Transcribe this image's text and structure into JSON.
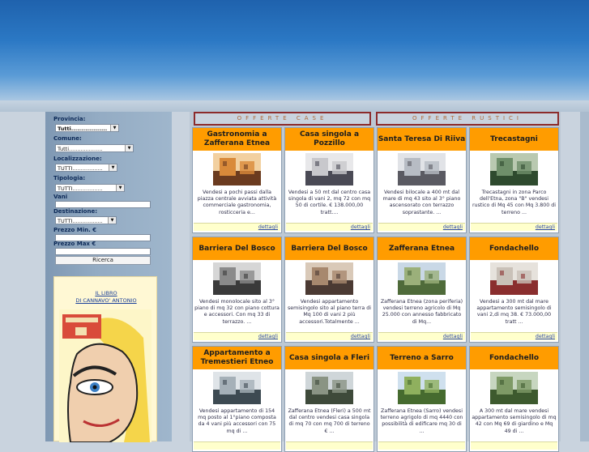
{
  "filters": {
    "provincia": {
      "label": "Provincia:",
      "value": "Tutti.................."
    },
    "comune": {
      "label": "Comune:",
      "value": "Tutti...................."
    },
    "localizzazione": {
      "label": "Localizzazione:",
      "value": "TUTTI.................."
    },
    "tipologia": {
      "label": "Tipologia:",
      "value": "TUTTI.................."
    },
    "vani": {
      "label": "Vani"
    },
    "destinazione": {
      "label": "Destinazione:",
      "value": "TUTTI.................."
    },
    "prezzo_min": {
      "label": "Prezzo Min. €"
    },
    "prezzo_max": {
      "label": "Prezzo Max €"
    },
    "search_button": "Ricerca"
  },
  "book": {
    "title_line1": "IL LIBRO",
    "title_line2": "DI CANNAVO' ANTONIO"
  },
  "tabs": {
    "case": "OFFERTE CASE",
    "rustici": "OFFERTE RUSTICI"
  },
  "listings": [
    {
      "title": "Gastronomia a Zafferana Etnea",
      "desc": "Vendesi a pochi passi dalla piazza centrale avviata attività commerciale gastronomia, rosticceria e...",
      "link": "dettagli"
    },
    {
      "title": "Casa singola a Pozzillo",
      "desc": "Vendesi a 50 mt dal centro casa singola di vani 2, mq 72 con mq 50 di cortile. € 138.000,00 tratt....",
      "link": "dettagli"
    },
    {
      "title": "Santa Teresa Di Riiva",
      "desc": "Vendesi bilocale a 400 mt dal mare di mq 43 sito al 3° piano ascensorato con terrazzo soprastante. ...",
      "link": "dettagli"
    },
    {
      "title": "Trecastagni",
      "desc": "Trecastagni in zona Parco dell'Etna, zona \"B\" vendesi rustico di Mq 45 con Mq 3.800 di terreno ...",
      "link": "dettagli"
    },
    {
      "title": "Barriera Del Bosco",
      "desc": "Vendesi monolocale sito al 3° piano di mq 32 con piano cottura e accessori. Con mq 33 di terrazzo. ...",
      "link": "dettagli"
    },
    {
      "title": "Barriera Del Bosco",
      "desc": "Vendesi appartamento semisingolo sito al piano terra di Mq 100 di vani 2 più accessori.Totalmente ...",
      "link": "dettagli"
    },
    {
      "title": "Zafferana Etnea",
      "desc": "Zafferana Etnea (zona periferia) vendesi terreno agricolo di Mq 25.000 con annesso fabbricato di Mq...",
      "link": "dettagli"
    },
    {
      "title": "Fondachello",
      "desc": "Vendesi a 300 mt dal mare appartamento semisingolo di vani 2,di mq 38. € 73.000,00 tratt ...",
      "link": "dettagli"
    },
    {
      "title": "Appartamento a Tremestieri Etneo",
      "desc": "Vendesi appartamento di 154 mq posto al 1°piano composta da 4 vani più accessori con 75 mq di ...",
      "link": ""
    },
    {
      "title": "Casa singola a Fleri",
      "desc": "Zafferana Etnea (Fleri) a 500 mt dal centro vendesi casa singola di mq 70 con mq 700 di terreno € ...",
      "link": ""
    },
    {
      "title": "Terreno a Sarro",
      "desc": "Zafferana Etnea (Sarro) vendesi terreno agrigolo di mq 4440 con possibilità di edificare mq 30 di ...",
      "link": ""
    },
    {
      "title": "Fondachello",
      "desc": "A 300 mt dal mare vendesi appartamento semisingolo di mq 42 con Mq 69 di giardino e Mq 49 di ...",
      "link": ""
    }
  ]
}
